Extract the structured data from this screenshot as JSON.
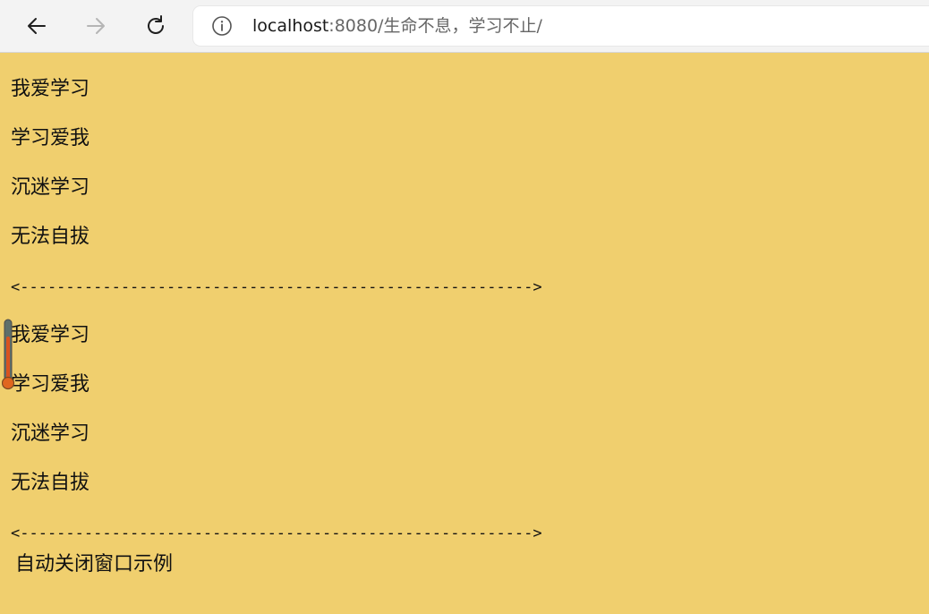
{
  "browser": {
    "url_host": "localhost",
    "url_rest": ":8080/生命不息，学习不止/"
  },
  "content": {
    "block1": [
      "我爱学习",
      "学习爱我",
      "沉迷学习",
      "无法自拔"
    ],
    "separator1": "<-------------------------------------------------------->",
    "block2": [
      "我爱学习",
      "学习爱我",
      "沉迷学习",
      "无法自拔"
    ],
    "separator2": "<-------------------------------------------------------->",
    "footer": "自动关闭窗口示例"
  },
  "colors": {
    "page_background": "#f0cf6e",
    "toolbar_background": "#f3f3f3"
  },
  "icons": {
    "back": "back-arrow-icon",
    "forward": "forward-arrow-icon",
    "reload": "reload-icon",
    "info": "info-icon",
    "widget": "thermometer-icon"
  }
}
